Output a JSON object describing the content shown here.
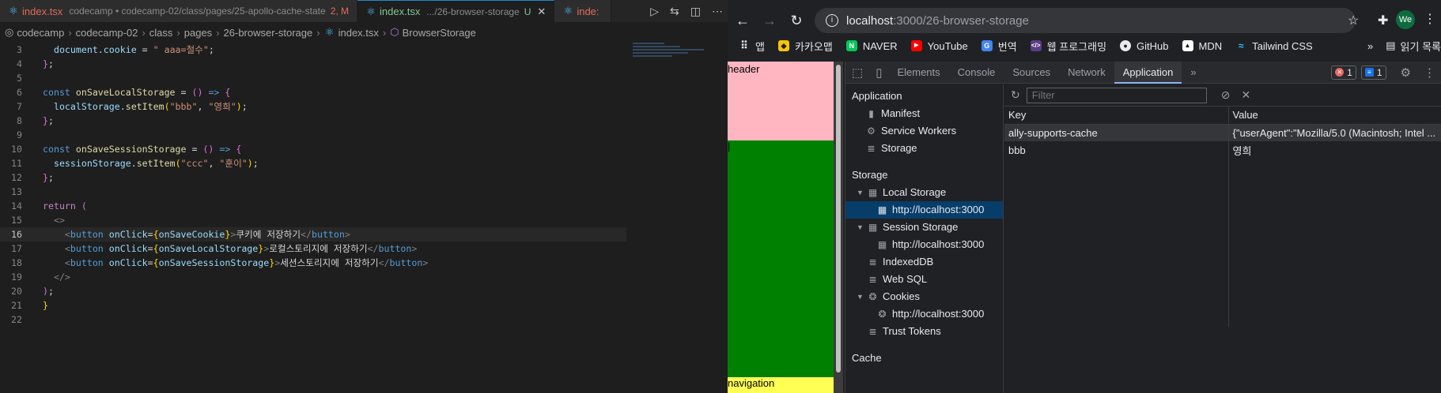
{
  "vscode": {
    "tabs": [
      {
        "label": "index.tsx",
        "desc": "codecamp • codecamp-02/class/pages/25-apollo-cache-state",
        "status": "2, M",
        "active": false
      },
      {
        "label": "index.tsx",
        "desc": ".../26-browser-storage",
        "status": "U",
        "active": true
      },
      {
        "label": "inde:",
        "desc": "",
        "status": "",
        "active": false
      }
    ],
    "breadcrumb": [
      "codecamp",
      "codecamp-02",
      "class",
      "pages",
      "26-browser-storage",
      "index.tsx",
      "BrowserStorage"
    ],
    "current_line": 16
  },
  "code_lines": [
    "3",
    "4",
    "5",
    "6",
    "7",
    "8",
    "9",
    "10",
    "11",
    "12",
    "13",
    "14",
    "15",
    "16",
    "17",
    "18",
    "19",
    "20",
    "21",
    "22"
  ],
  "browser": {
    "url_host": "localhost",
    "url_path": ":3000/26-browser-storage",
    "profile": "We",
    "bookmarks": [
      "앱",
      "카카오맵",
      "NAVER",
      "YouTube",
      "번역",
      "웹 프로그래밍",
      "GitHub",
      "MDN",
      "Tailwind CSS"
    ],
    "bookmarks_more": "»",
    "reading_list": "읽기 목록",
    "page": {
      "header": "header",
      "main": "|",
      "navigation": "navigation"
    }
  },
  "devtools": {
    "tabs": [
      "Elements",
      "Console",
      "Sources",
      "Network",
      "Application"
    ],
    "active_tab": "Application",
    "more": "»",
    "error_count": "1",
    "message_count": "1",
    "filter_placeholder": "Filter",
    "sidebar": {
      "application_heading": "Application",
      "application_items": [
        "Manifest",
        "Service Workers",
        "Storage"
      ],
      "storage_heading": "Storage",
      "local_storage": "Local Storage",
      "local_origin": "http://localhost:3000",
      "session_storage": "Session Storage",
      "session_origin": "http://localhost:3000",
      "indexeddb": "IndexedDB",
      "websql": "Web SQL",
      "cookies": "Cookies",
      "cookies_origin": "http://localhost:3000",
      "trust_tokens": "Trust Tokens",
      "cache_heading": "Cache"
    },
    "table": {
      "headers": [
        "Key",
        "Value"
      ],
      "rows": [
        {
          "key": "ally-supports-cache",
          "value": "{\"userAgent\":\"Mozilla/5.0 (Macintosh; Intel ..."
        },
        {
          "key": "bbb",
          "value": "영희"
        }
      ]
    }
  }
}
